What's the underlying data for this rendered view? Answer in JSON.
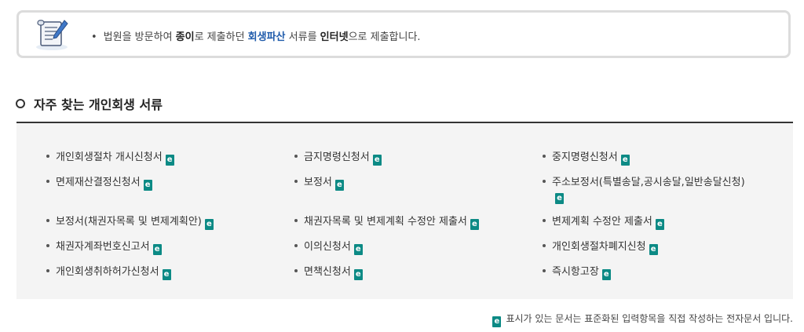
{
  "notice": {
    "bullet": "•",
    "part1": "법원을 방문하여 ",
    "bold1": "종이",
    "part2": "로 제출하던 ",
    "bold2": "회생파산",
    "part3": " 서류를 ",
    "bold3": "인터넷",
    "part4": "으로 제출합니다."
  },
  "section": {
    "title": "자주 찾는 개인회생 서류"
  },
  "docs": [
    "개인회생절차 개시신청서",
    "금지명령신청서",
    "중지명령신청서",
    "면제재산결정신청서",
    "보정서",
    "주소보정서(특별송달,공시송달,일반송달신청)",
    "보정서(채권자목록 및 변제계획안)",
    "채권자목록 및 변제계획 수정안 제출서",
    "변제계획 수정안 제출서",
    "채권자계좌번호신고서",
    "이의신청서",
    "개인회생절차폐지신청",
    "개인회생취하허가신청서",
    "면책신청서",
    "즉시항고장"
  ],
  "footer": {
    "note": "표시가 있는 문서는 표준화된 입력항목을 직접 작성하는 전자문서 입니다."
  },
  "colors": {
    "eform_icon": "#0c8a85",
    "highlight_blue": "#1f5bab",
    "panel_bg": "#f4f4f4"
  },
  "icons": {
    "notice": "document-pen-icon",
    "eform": "e-form-icon"
  }
}
